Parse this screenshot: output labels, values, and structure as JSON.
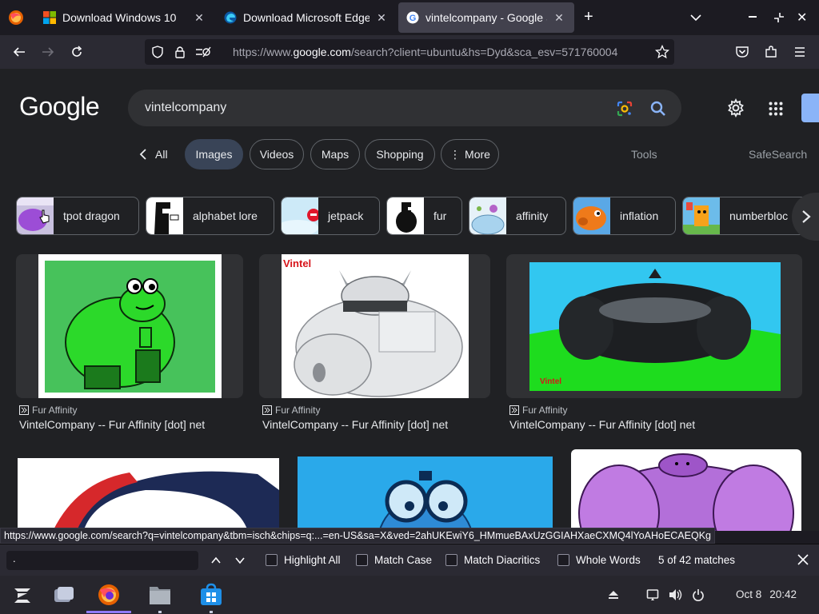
{
  "browser": {
    "tabs": [
      {
        "title": "Download Windows 10",
        "icon": "windows-logo-icon",
        "active": false
      },
      {
        "title": "Download Microsoft Edge",
        "icon": "edge-logo-icon",
        "active": false
      },
      {
        "title": "vintelcompany - Google Se",
        "icon": "google-g-icon",
        "active": true
      }
    ],
    "new_tab_label": "+",
    "url_prefix": "https://www.",
    "url_domain": "google.com",
    "url_rest": "/search?client=ubuntu&hs=Dyd&sca_esv=571760004"
  },
  "google": {
    "logo": "Google",
    "query": "vintelcompany",
    "nav": {
      "all": "All",
      "images": "Images",
      "videos": "Videos",
      "maps": "Maps",
      "shopping": "Shopping",
      "more": "More",
      "tools": "Tools",
      "safesearch": "SafeSearch"
    },
    "chips": [
      {
        "label": "tpot dragon"
      },
      {
        "label": "alphabet lore"
      },
      {
        "label": "jetpack"
      },
      {
        "label": "fur"
      },
      {
        "label": "affinity"
      },
      {
        "label": "inflation"
      },
      {
        "label": "numberbloc"
      }
    ],
    "results": [
      {
        "source": "Fur Affinity",
        "title": "VintelCompany -- Fur Affinity [dot] net"
      },
      {
        "source": "Fur Affinity",
        "title": "VintelCompany -- Fur Affinity [dot] net",
        "image_text": "Vintel"
      },
      {
        "source": "Fur Affinity",
        "title": "VintelCompany -- Fur Affinity [dot] net",
        "image_text": "Vintel"
      }
    ]
  },
  "status_link": "https://www.google.com/search?q=vintelcompany&tbm=isch&chips=q:...=en-US&sa=X&ved=2ahUKEwiY6_HMmueBAxUzGGIAHXaeCXMQ4lYoAHoECAEQKg",
  "findbar": {
    "input_value": ".",
    "highlight_all": "Highlight All",
    "match_case": "Match Case",
    "match_diacritics": "Match Diacritics",
    "whole_words": "Whole Words",
    "match_count": "5 of 42 matches"
  },
  "taskbar": {
    "date": "Oct 8",
    "time": "20:42"
  },
  "colors": {
    "page_bg": "#202124",
    "active_pill": "#394457",
    "accent_blue": "#8ab4f8"
  }
}
